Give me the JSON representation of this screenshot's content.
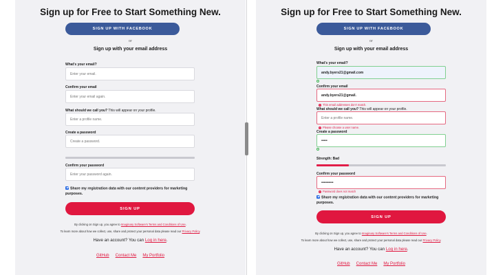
{
  "left": {
    "title": "Sign up for Free to Start Something New.",
    "facebook_button": "SIGN UP WITH FACEBOOK",
    "or": "or",
    "subhead": "Sign up with your email address",
    "email": {
      "label": "What's your email?",
      "placeholder": "Enter your email."
    },
    "confirm_email": {
      "label": "Confirm your email",
      "placeholder": "Enter your email again."
    },
    "name": {
      "label": "What should we call you?",
      "hint": " This will appear on your profile.",
      "placeholder": "Enter a profile name."
    },
    "password": {
      "label": "Create a password",
      "placeholder": "Create a password."
    },
    "confirm_password": {
      "label": "Confirm your password",
      "placeholder": "Enter your password again."
    },
    "strength_fraction": 0,
    "share_checkbox": {
      "checked": true,
      "label": "Share my registration data with our content providers for marketing purposes."
    },
    "signup_button": "SIGN UP",
    "terms": {
      "prefix": "By clicking on Sign up, you agree to ",
      "link": "Imaginary Software's Terms and Conditions of Use",
      "suffix": "."
    },
    "privacy": {
      "prefix": "To learn more about how we collect, use, share and protect your personal data please read our ",
      "link": "Privacy Policy",
      "suffix": "."
    },
    "login": {
      "prefix": "Have an account? You can ",
      "link": "Log in here",
      "suffix": "."
    },
    "footer_links": [
      "GitHub",
      "Contact Me",
      "My Portfolio"
    ]
  },
  "right": {
    "title": "Sign up for Free to Start Something New.",
    "facebook_button": "SIGN UP WITH FACEBOOK",
    "or": "or",
    "subhead": "Sign up with your email address",
    "email": {
      "label": "What's your email?",
      "value": "andy.byers21@gmail.com"
    },
    "confirm_email": {
      "label": "Confirm your email",
      "value": "andy.byers21@gmail.",
      "error": "This email addresses don't match."
    },
    "name": {
      "label": "What should we call you?",
      "hint": " This will appear on your profile.",
      "placeholder": "Enter a profile name.",
      "error": "Please choose a user name."
    },
    "password": {
      "label": "Create a password",
      "value": "•••••"
    },
    "strength": {
      "label": "Strength: Bad",
      "fraction": 0.25
    },
    "confirm_password": {
      "label": "Confirm your password",
      "value": "••••••••••",
      "error": "Password does not match"
    },
    "share_checkbox": {
      "checked": true,
      "label": "Share my registration data with our content providers for marketing purposes."
    },
    "signup_button": "SIGN UP",
    "terms": {
      "prefix": "By clicking on Sign up, you agree to ",
      "link": "Imaginary Software's Terms and Conditions of Use",
      "suffix": "."
    },
    "privacy": {
      "prefix": "To learn more about how we collect, use, share and protect your personal data please read our ",
      "link": "Privacy Policy",
      "suffix": "."
    },
    "login": {
      "prefix": "Have an account? You can ",
      "link": "Log in here",
      "suffix": "."
    },
    "footer_links": [
      "GitHub",
      "Contact Me",
      "My Portfolio"
    ]
  },
  "colors": {
    "facebook": "#3b5a9a",
    "accent_red": "#e0173f",
    "valid_green": "#7fcf8f",
    "panel_bg": "#f1f1f4"
  }
}
